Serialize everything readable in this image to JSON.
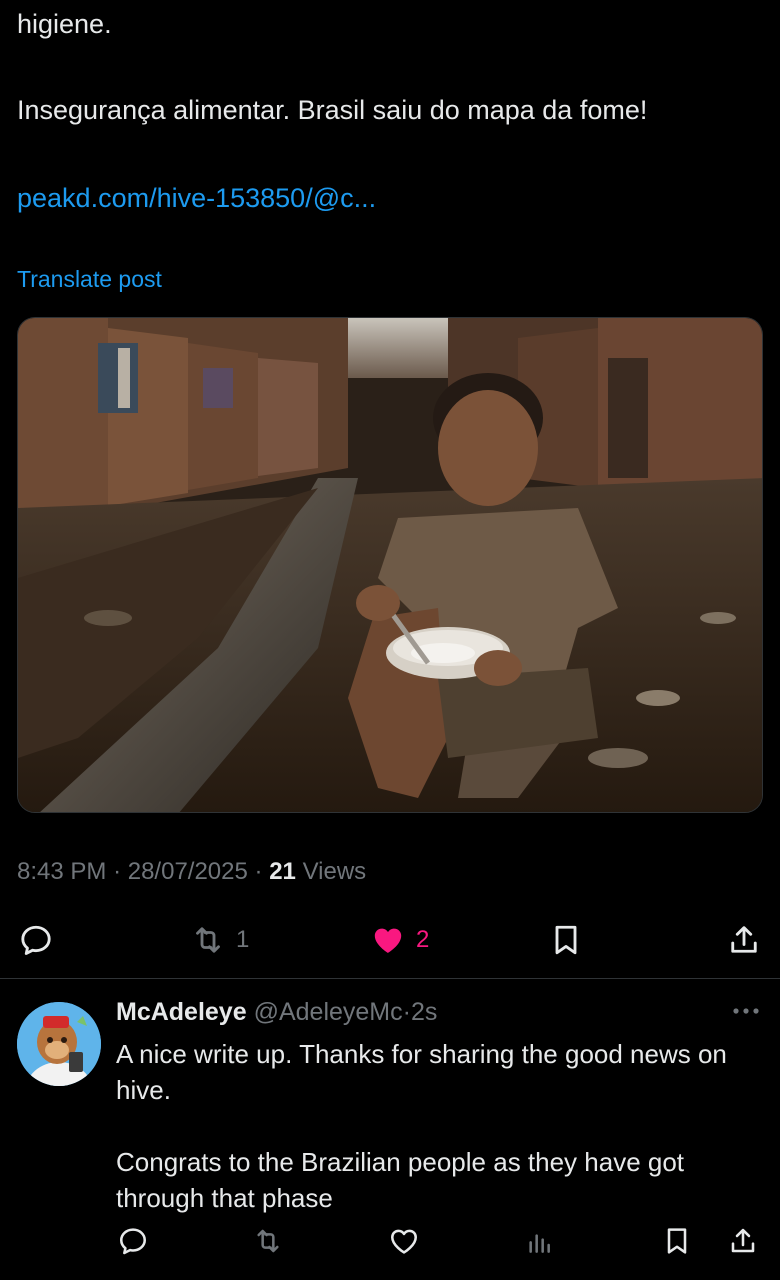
{
  "post": {
    "text_line_1": "higiene.",
    "text_line_2": "Insegurança alimentar. Brasil saiu do mapa da fome!",
    "link": "peakd.com/hive-153850/@c...",
    "translate": "Translate post",
    "time": "8:43 PM",
    "date": "28/07/2025",
    "views_count": "21",
    "views_label": "Views",
    "retweets": "1",
    "likes": "2"
  },
  "reply": {
    "name": "McAdeleye",
    "handle": "@AdeleyeMc",
    "time": "2s",
    "body_1": "A nice write up. Thanks for sharing the good news on hive.",
    "body_2": "Congrats to the Brazilian people as they have got through that phase"
  },
  "colors": {
    "accent": "#1d9bf0",
    "like": "#f91880",
    "muted": "#71767b",
    "text": "#e7e9ea",
    "border": "#2f3336"
  },
  "icons": [
    "reply-icon",
    "retweet-icon",
    "heart-icon",
    "bookmark-icon",
    "share-icon",
    "more-icon",
    "views-icon"
  ]
}
